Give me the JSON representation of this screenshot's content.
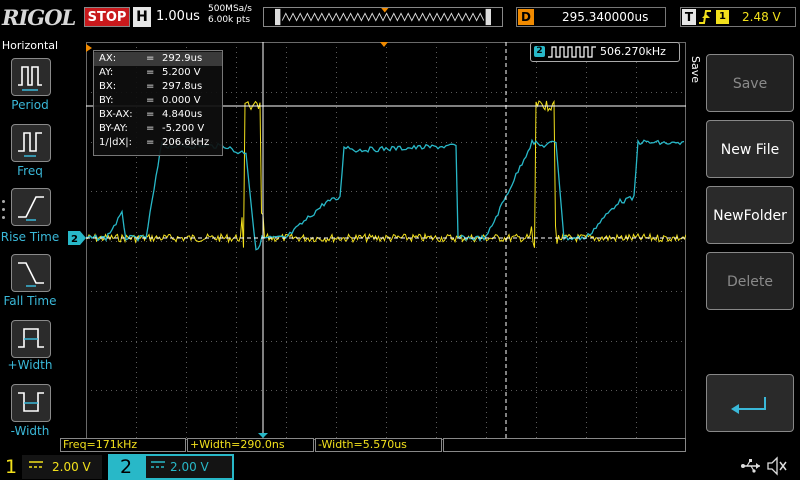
{
  "brand": "RIGOL",
  "top_bar": {
    "run_state": "STOP",
    "timebase_label": "H",
    "timebase_value": "1.00us",
    "sample_rate": "500MSa/s",
    "memory_depth": "6.00k pts",
    "trigger_pos_label": "D",
    "trigger_pos_value": "295.340000us",
    "trigger_type_label": "T",
    "trigger_slope_icon": "rising-edge-icon",
    "trigger_source": "1",
    "trigger_level": "2.48 V"
  },
  "left_menu": {
    "title": "Horizontal",
    "items": [
      {
        "label": "Period",
        "icon": "period-icon"
      },
      {
        "label": "Freq",
        "icon": "freq-icon"
      },
      {
        "label": "Rise Time",
        "icon": "rise-time-icon"
      },
      {
        "label": "Fall Time",
        "icon": "fall-time-icon"
      },
      {
        "label": "+Width",
        "icon": "pos-width-icon"
      },
      {
        "label": "-Width",
        "icon": "neg-width-icon"
      }
    ]
  },
  "right_menu": {
    "title": "Save",
    "items": [
      {
        "label": "Save",
        "enabled": false
      },
      {
        "label": "New File",
        "enabled": true
      },
      {
        "label": "NewFolder",
        "enabled": true
      },
      {
        "label": "Delete",
        "enabled": false
      },
      {
        "label": "",
        "icon": "return-arrow-icon",
        "enabled": true
      }
    ]
  },
  "cursor": {
    "rows": [
      {
        "key": "AX:",
        "eq": "=",
        "value": "292.9us"
      },
      {
        "key": "AY:",
        "eq": "=",
        "value": "5.200 V"
      },
      {
        "key": "BX:",
        "eq": "=",
        "value": "297.8us"
      },
      {
        "key": "BY:",
        "eq": "=",
        "value": "0.000 V"
      },
      {
        "key": "BX-AX:",
        "eq": "=",
        "value": "4.840us"
      },
      {
        "key": "BY-AY:",
        "eq": "=",
        "value": "-5.200 V"
      },
      {
        "key": "1/|dX|:",
        "eq": "=",
        "value": "206.6kHz"
      }
    ]
  },
  "counter": {
    "channel": "2",
    "value": "506.270kHz"
  },
  "channel_markers": {
    "ch2": "2",
    "trigger_level": "T"
  },
  "measurements": [
    "Freq=171kHz",
    "+Width=290.0ns",
    "-Width=5.570us",
    ""
  ],
  "channels": [
    {
      "number": "1",
      "scale": "2.00 V",
      "color": "#f2e01c"
    },
    {
      "number": "2",
      "scale": "2.00 V",
      "color": "#28b8c8"
    }
  ],
  "colors": {
    "ch1": "#f2e01c",
    "ch2": "#28b8c8",
    "accent_orange": "#f08a00",
    "stop_red": "#c8191c"
  }
}
